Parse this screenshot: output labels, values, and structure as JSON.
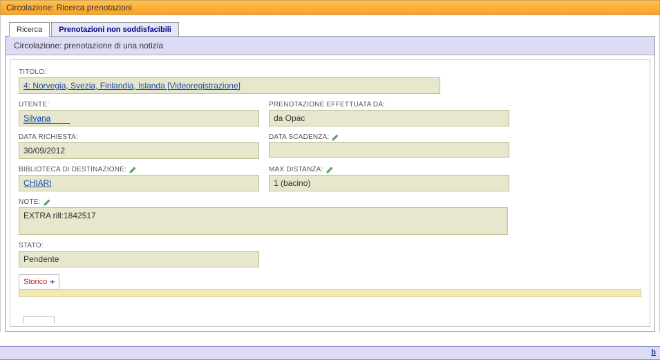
{
  "titleBar": "Circolazione: Ricerca prenotazioni",
  "tabs": {
    "search": "Ricerca",
    "unfulfillable": "Prenotazioni non soddisfacibili"
  },
  "subHeader": "Circolazione: prenotazione di una notizia",
  "labels": {
    "titolo": "TITOLO:",
    "utente": "UTENTE:",
    "prenotazioneDa": "PRENOTAZIONE EFFETTUATA DA:",
    "dataRichiesta": "DATA RICHIESTA:",
    "dataScadenza": "DATA SCADENZA:",
    "biblioteca": "BIBLIOTECA DI DESTINAZIONE:",
    "maxDistanza": "MAX DISTANZA:",
    "note": "NOTE:",
    "stato": "STATO:"
  },
  "values": {
    "titolo": "4: Norvegia, Svezia, Finlandia, Islanda [Videoregistrazione]",
    "utente": "Silvana",
    "prenotazioneDa": "da Opac",
    "dataRichiesta": "30/09/2012",
    "dataScadenza": "",
    "biblioteca": "CHIARI",
    "maxDistanza": "1 (bacino)",
    "note": "EXTRA rill:1842517",
    "stato": "Pendente"
  },
  "buttons": {
    "storico": "Storico"
  },
  "footer": {
    "linkChar": "b"
  }
}
